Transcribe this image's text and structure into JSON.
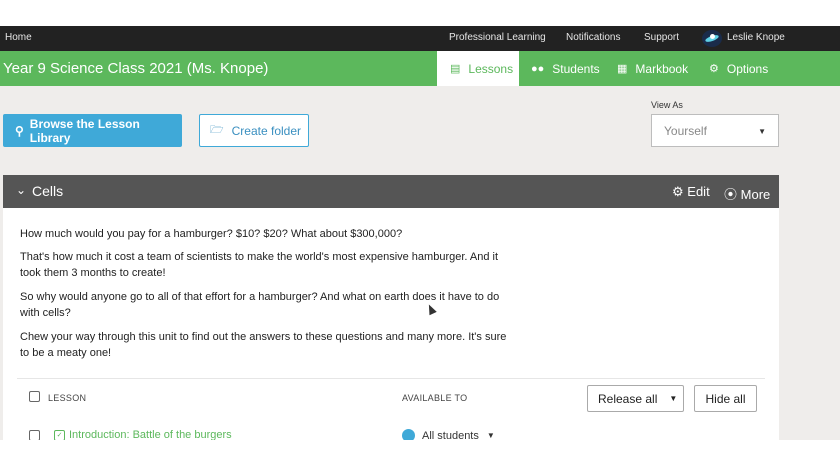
{
  "topnav": {
    "home": "Home",
    "links": [
      "Professional Learning",
      "Notifications",
      "Support"
    ],
    "user_name": "Leslie Knope"
  },
  "titlebar": {
    "title": "Year 9 Science Class 2021 (Ms. Knope)",
    "tabs": [
      {
        "label": "Lessons",
        "icon": "document-icon",
        "active": true
      },
      {
        "label": "Students",
        "icon": "users-icon",
        "active": false
      },
      {
        "label": "Markbook",
        "icon": "grid-icon",
        "active": false
      },
      {
        "label": "Options",
        "icon": "gear-icon",
        "active": false
      }
    ]
  },
  "toolbar": {
    "browse_label": "Browse the Lesson Library",
    "create_folder_label": "Create folder",
    "view_as_label": "View As",
    "view_as_value": "Yourself"
  },
  "panel": {
    "title": "Cells",
    "edit_label": "Edit",
    "more_label": "More",
    "paragraphs": [
      "How much would you pay for a hamburger? $10? $20? What about $300,000?",
      "That's how much it cost a team of scientists to make the world's most expensive hamburger. And it took them 3 months to create!",
      "So why would anyone go to all of that effort for a hamburger? And what on earth does it have to do with cells?",
      "Chew your way through this unit to find out the answers to these questions and many more. It's sure to be a meaty one!"
    ]
  },
  "table": {
    "col_lesson": "LESSON",
    "col_available": "AVAILABLE TO",
    "release_all_label": "Release all",
    "hide_all_label": "Hide all",
    "rows": [
      {
        "title": "Introduction: Battle of the burgers",
        "available": "All students"
      }
    ]
  },
  "colors": {
    "brand_green": "#5cb85c",
    "accent_blue": "#3fa9d8",
    "nav_dark": "#222222",
    "panel_header": "#555555"
  }
}
